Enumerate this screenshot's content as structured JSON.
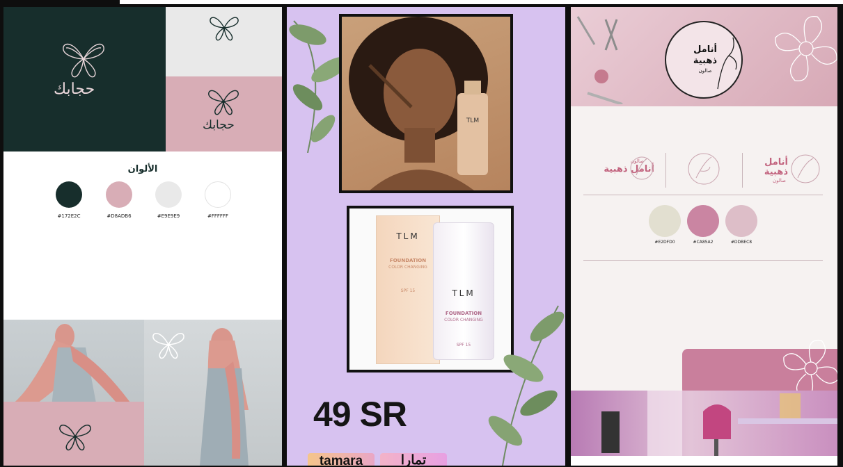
{
  "boards": {
    "hijabak": {
      "logo_text": "حجابك",
      "colors_title": "الألوان",
      "palette": [
        {
          "hex": "#172E2C",
          "label": "#172E2C"
        },
        {
          "hex": "#D8ADB6",
          "label": "#D8ADB6"
        },
        {
          "hex": "#E9E9E9",
          "label": "#E9E9E9"
        },
        {
          "hex": "#FFFFFF",
          "label": "#FFFFFF"
        }
      ],
      "icon": "butterfly-icon"
    },
    "foundation_ad": {
      "background": "#D7C2F0",
      "product_brand": "TLM",
      "product_line1": "FOUNDATION",
      "product_line2": "COLOR CHANGING",
      "spf": "SPF 15",
      "price": "49 SR",
      "payment_tamara": "tamara",
      "payment_tabby": "تمارا"
    },
    "salon": {
      "logo_title_line1": "أنامل",
      "logo_title_line2": "ذهبية",
      "logo_subtitle": "صالون",
      "variant_text_inline": "أنامل ذهبية",
      "variant_small": "صالون",
      "palette": [
        {
          "hex": "#E2DFD0",
          "label": "#E2DFD0"
        },
        {
          "hex": "#CA85A2",
          "label": "#CA85A2"
        },
        {
          "hex": "#DDBEC8",
          "label": "#DDBEC8"
        }
      ],
      "icon": "hand-leaf-icon"
    }
  }
}
